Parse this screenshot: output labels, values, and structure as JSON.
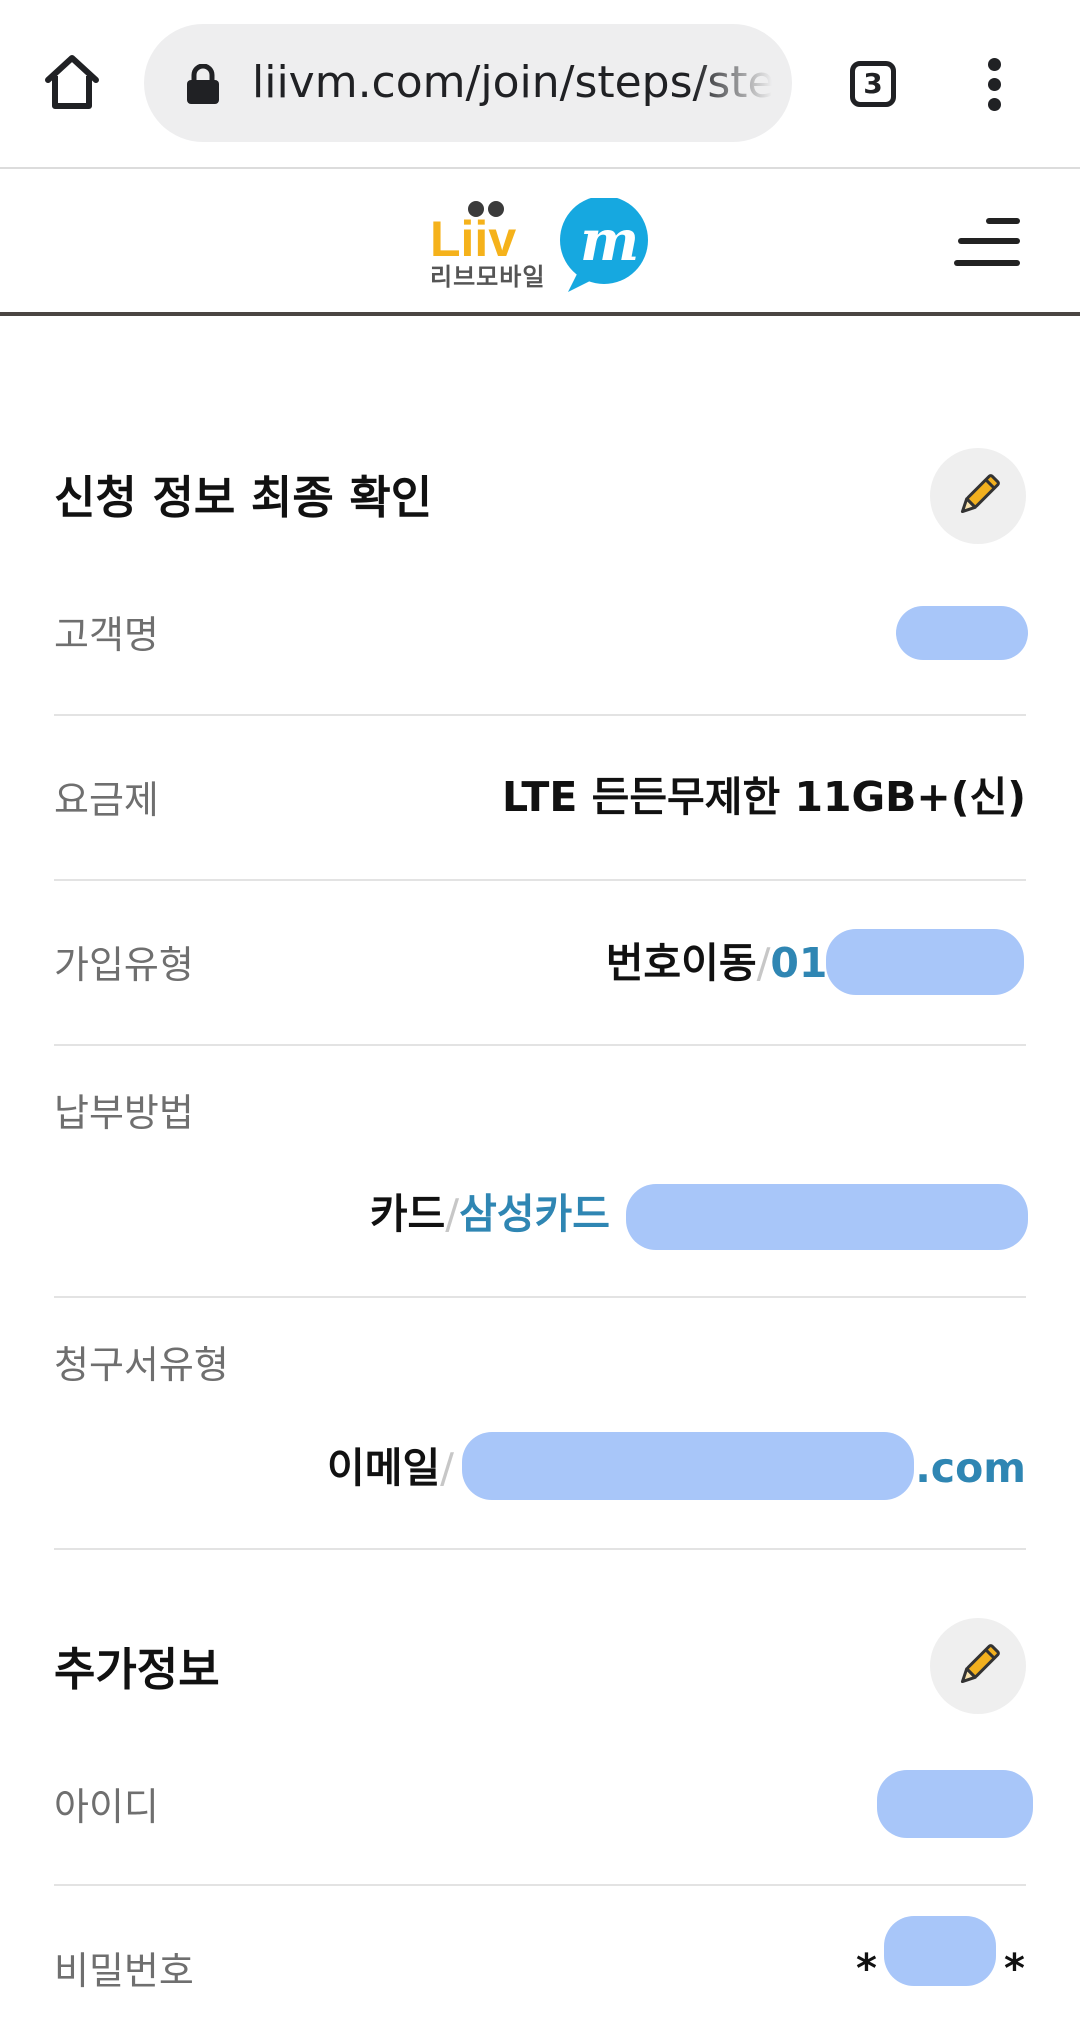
{
  "browser": {
    "url": "liivm.com/join/steps/step",
    "tab_count": "3"
  },
  "header": {
    "logo_word": "Liiv",
    "logo_m": "m",
    "logo_subtitle": "리브모바일"
  },
  "section_confirm": {
    "title": "신청 정보 최종 확인",
    "rows": {
      "customer_name_label": "고객명",
      "plan_label": "요금제",
      "plan_value": "LTE 든든무제한 11GB+(신)",
      "join_type_label": "가입유형",
      "join_type_value": "번호이동",
      "join_type_separator": "/",
      "join_type_number_prefix": "010",
      "payment_label": "납부방법",
      "payment_value": "카드",
      "payment_separator": "/",
      "payment_card": "삼성카드",
      "bill_label": "청구서유형",
      "bill_value": "이메일",
      "bill_separator": "/",
      "bill_email_suffix": ".com"
    }
  },
  "section_additional": {
    "title": "추가정보",
    "rows": {
      "id_label": "아이디",
      "password_label": "비밀번호",
      "password_mask_start": "*",
      "password_mask_end": "*"
    }
  },
  "colors": {
    "accent_blue": "#2f86b3",
    "redaction": "#a8c6f9",
    "logo_yellow": "#f5b21b",
    "logo_blue": "#16a8e0",
    "pencil_yellow": "#f2b01e"
  }
}
